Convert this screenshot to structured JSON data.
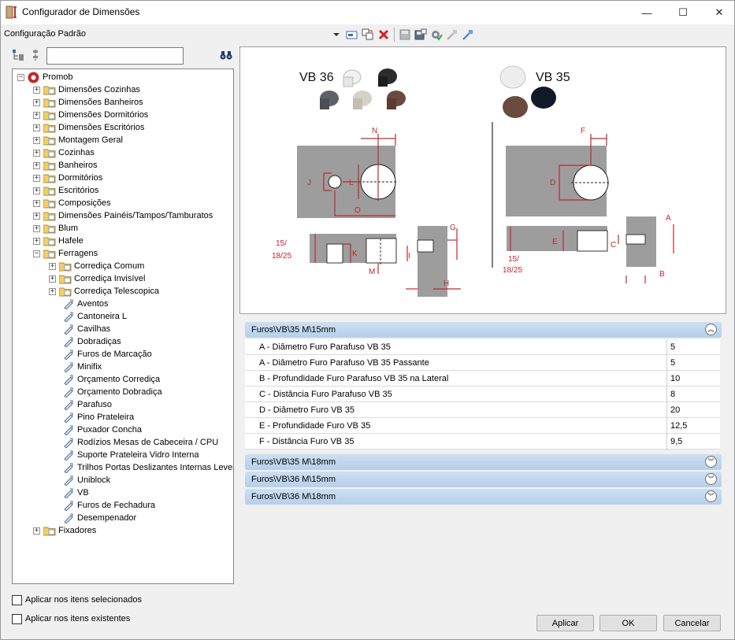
{
  "window": {
    "title": "Configurador de Dimensões",
    "minimize": "—",
    "maximize": "☐",
    "close": "✕"
  },
  "config": {
    "selected": "Configuração Padrão"
  },
  "search": {
    "value": ""
  },
  "tree": {
    "root": "Promob",
    "items": [
      "Dimensões Cozinhas",
      "Dimensões Banheiros",
      "Dimensões Dormitórios",
      "Dimensões Escritórios",
      "Montagem Geral",
      "Cozinhas",
      "Banheiros",
      "Dormitórios",
      "Escritórios",
      "Composições",
      "Dimensões Painéis/Tampos/Tamburatos",
      "Blum",
      "Hafele",
      "Ferragens",
      "Corrediça Comum",
      "Corrediça Invisível",
      "Corrediça Telescopica",
      "Aventos",
      "Cantoneira L",
      "Cavilhas",
      "Dobradiças",
      "Furos de Marcação",
      "Minifix",
      "Orçamento Corrediça",
      "Orçamento Dobradiça",
      "Parafuso",
      "Pino Prateleira",
      "Puxador Concha",
      "Rodízios Mesas de Cabeceira / CPU",
      "Suporte Prateleira Vidro Interna",
      "Trilhos Portas Deslizantes Internas Leves",
      "Uniblock",
      "VB",
      "Furos de Fechadura",
      "Desempenador",
      "Fixadores"
    ]
  },
  "diagram": {
    "vb36": "VB 36",
    "vb35": "VB 35",
    "letters": [
      "N",
      "J",
      "L",
      "O",
      "K",
      "M",
      "I",
      "G",
      "H",
      "F",
      "D",
      "E",
      "A",
      "C",
      "B"
    ],
    "thickness": "15/\n18/25"
  },
  "groups": [
    {
      "title": "Furos\\VB\\35 M\\15mm",
      "expanded": true,
      "rows": [
        {
          "name": "A - Diâmetro Furo Parafuso VB 35",
          "value": "5"
        },
        {
          "name": "A - Diâmetro Furo Parafuso VB 35 Passante",
          "value": "5"
        },
        {
          "name": "B - Profundidade Furo Parafuso VB 35 na Lateral",
          "value": "10"
        },
        {
          "name": "C - Distância Furo Parafuso VB 35",
          "value": "8"
        },
        {
          "name": "D - Diâmetro Furo VB 35",
          "value": "20"
        },
        {
          "name": "E - Profundidade Furo VB 35",
          "value": "12,5"
        },
        {
          "name": "F - Distância Furo VB 35",
          "value": "9,5"
        }
      ]
    },
    {
      "title": "Furos\\VB\\35 M\\18mm",
      "expanded": false
    },
    {
      "title": "Furos\\VB\\36 M\\15mm",
      "expanded": false
    },
    {
      "title": "Furos\\VB\\36 M\\18mm",
      "expanded": false
    }
  ],
  "options": {
    "apply_selected": "Aplicar nos itens selecionados",
    "apply_existing": "Aplicar nos itens existentes"
  },
  "buttons": {
    "apply": "Aplicar",
    "ok": "OK",
    "cancel": "Cancelar"
  },
  "colors": {
    "accent_red": "#c0282d",
    "group_blue": "#b6cfea",
    "plate_gray": "#9d9d9d"
  }
}
